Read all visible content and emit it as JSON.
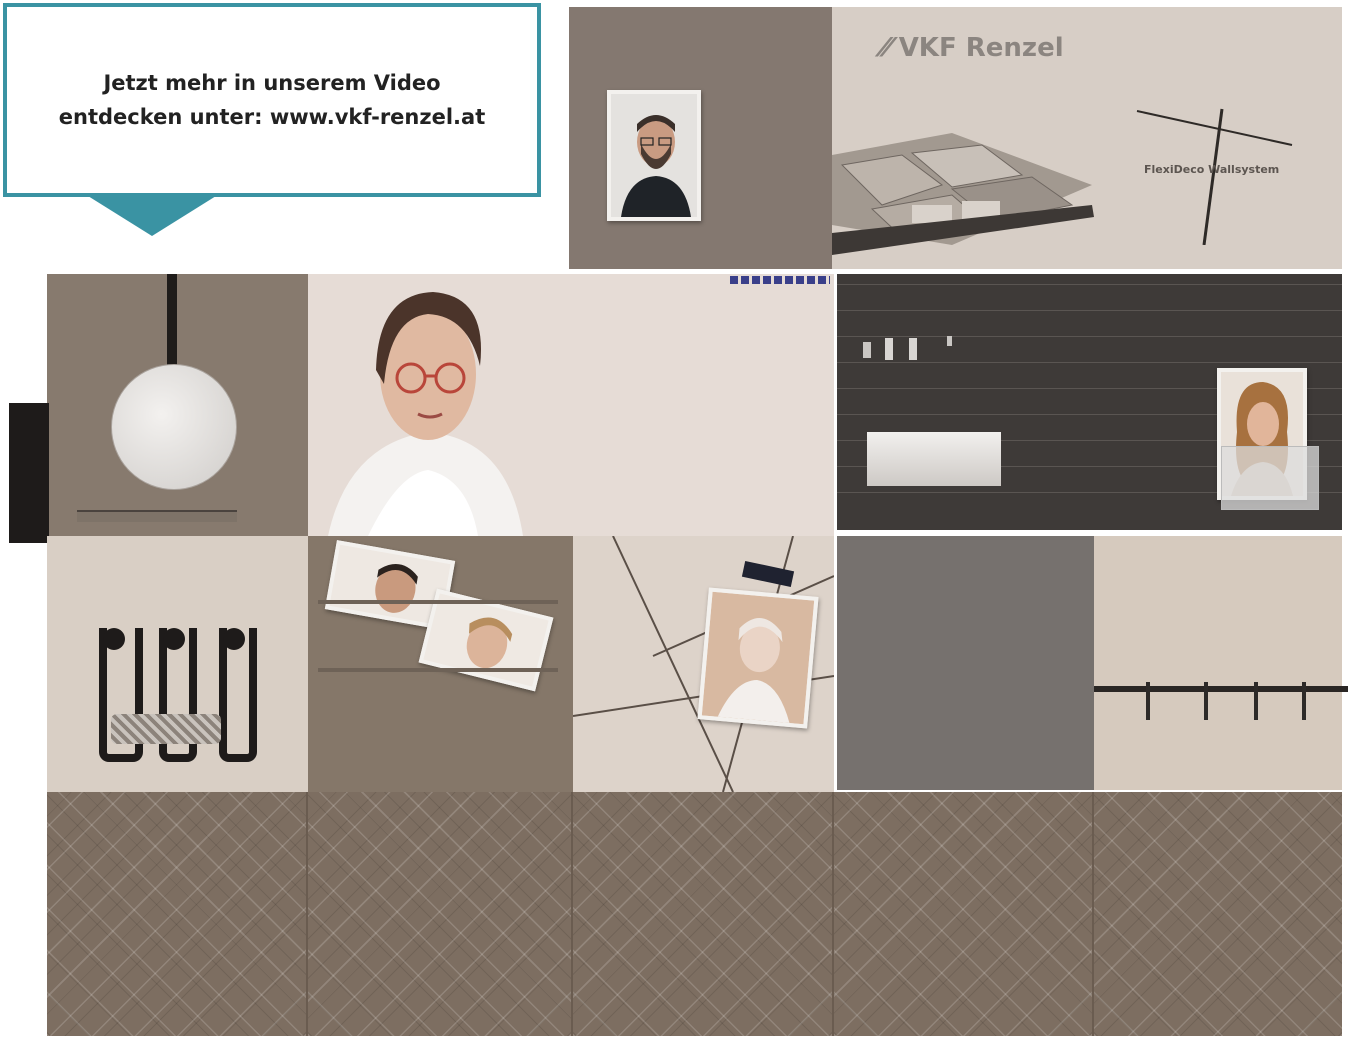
{
  "callout": {
    "line1": "Jetzt mehr in unserem Video",
    "line2": "entdecken unter: www.vkf-renzel.at",
    "border_color": "#3a93a3"
  },
  "brand": {
    "logo_text": "VKF Renzel",
    "logo_mark": "slash-logo-icon",
    "product_text": "FlexiDeco Wallsystem"
  },
  "colors": {
    "taupe": "#8a7c70",
    "beige": "#d8cdc3",
    "blush": "#e6dcd5",
    "dark_slats": "#3e3a38",
    "grey": "#77726e",
    "quilted": "#7d6e61"
  }
}
